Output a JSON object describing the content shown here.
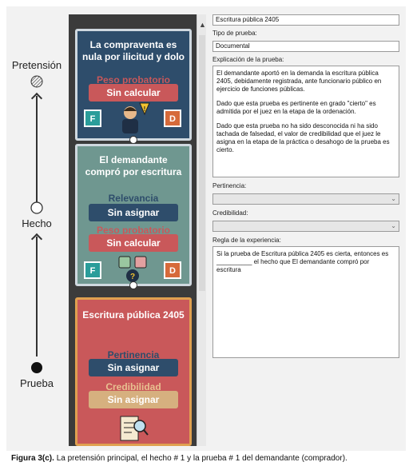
{
  "legend": {
    "pretension": "Pretensión",
    "hecho": "Hecho",
    "prueba": "Prueba"
  },
  "cards": {
    "pretension": {
      "title": "La compraventa es nula por ilicitud y dolo",
      "weight_label": "Peso probatorio",
      "weight_button": "Sin calcular",
      "badge_f": "F",
      "badge_d": "D"
    },
    "hecho": {
      "title": "El demandante compró por escritura",
      "relevance_label": "Relevancia",
      "relevance_button": "Sin asignar",
      "weight_label": "Peso probatorio",
      "weight_button": "Sin calcular",
      "badge_f": "F",
      "badge_d": "D"
    },
    "prueba": {
      "title": "Escritura pública 2405",
      "pertinence_label": "Pertinencia",
      "pertinence_button": "Sin asignar",
      "credibility_label": "Credibilidad",
      "credibility_button": "Sin asignar"
    }
  },
  "form": {
    "name_value": "Escritura pública 2405",
    "type_label": "Tipo de prueba:",
    "type_value": "Documental",
    "explanation_label": "Explicación de la prueba:",
    "explanation_p1": "El demandante aportó en la demanda la escritura pública 2405, debidamente registrada, ante funcionario público en ejercicio de funciones públicas.",
    "explanation_p2": "Dado que esta prueba es pertinente en grado \"cierto\" es admitida por el juez en la etapa de la ordenación.",
    "explanation_p3": "Dado que esta prueba no ha sido desconocida ni ha sido tachada de falsedad, el valor de credibilidad que el juez le asigna en la etapa de la práctica o desahogo de la prueba es cierto.",
    "pertinence_label": "Pertinencia:",
    "pertinence_value": "",
    "credibility_label": "Credibilidad:",
    "credibility_value": "",
    "rule_label": "Regla de la experiencia:",
    "rule_text": "Si la prueba de Escritura pública 2405 es cierta, entonces es __________ el hecho que El demandante compró por escritura"
  },
  "caption": {
    "prefix": "Figura 3(c).",
    "text": "La pretensión principal, el hecho # 1 y la prueba # 1 del demandante (comprador)."
  },
  "colors": {
    "pretension_card": "#2e4d6b",
    "hecho_card": "#6f9790",
    "prueba_card": "#c9585a",
    "button_blue": "#2e4d6b",
    "button_red": "#c9585a",
    "button_tan": "#d6b07f",
    "badge_teal": "#2a9d9a",
    "badge_orange": "#d66a3a"
  }
}
